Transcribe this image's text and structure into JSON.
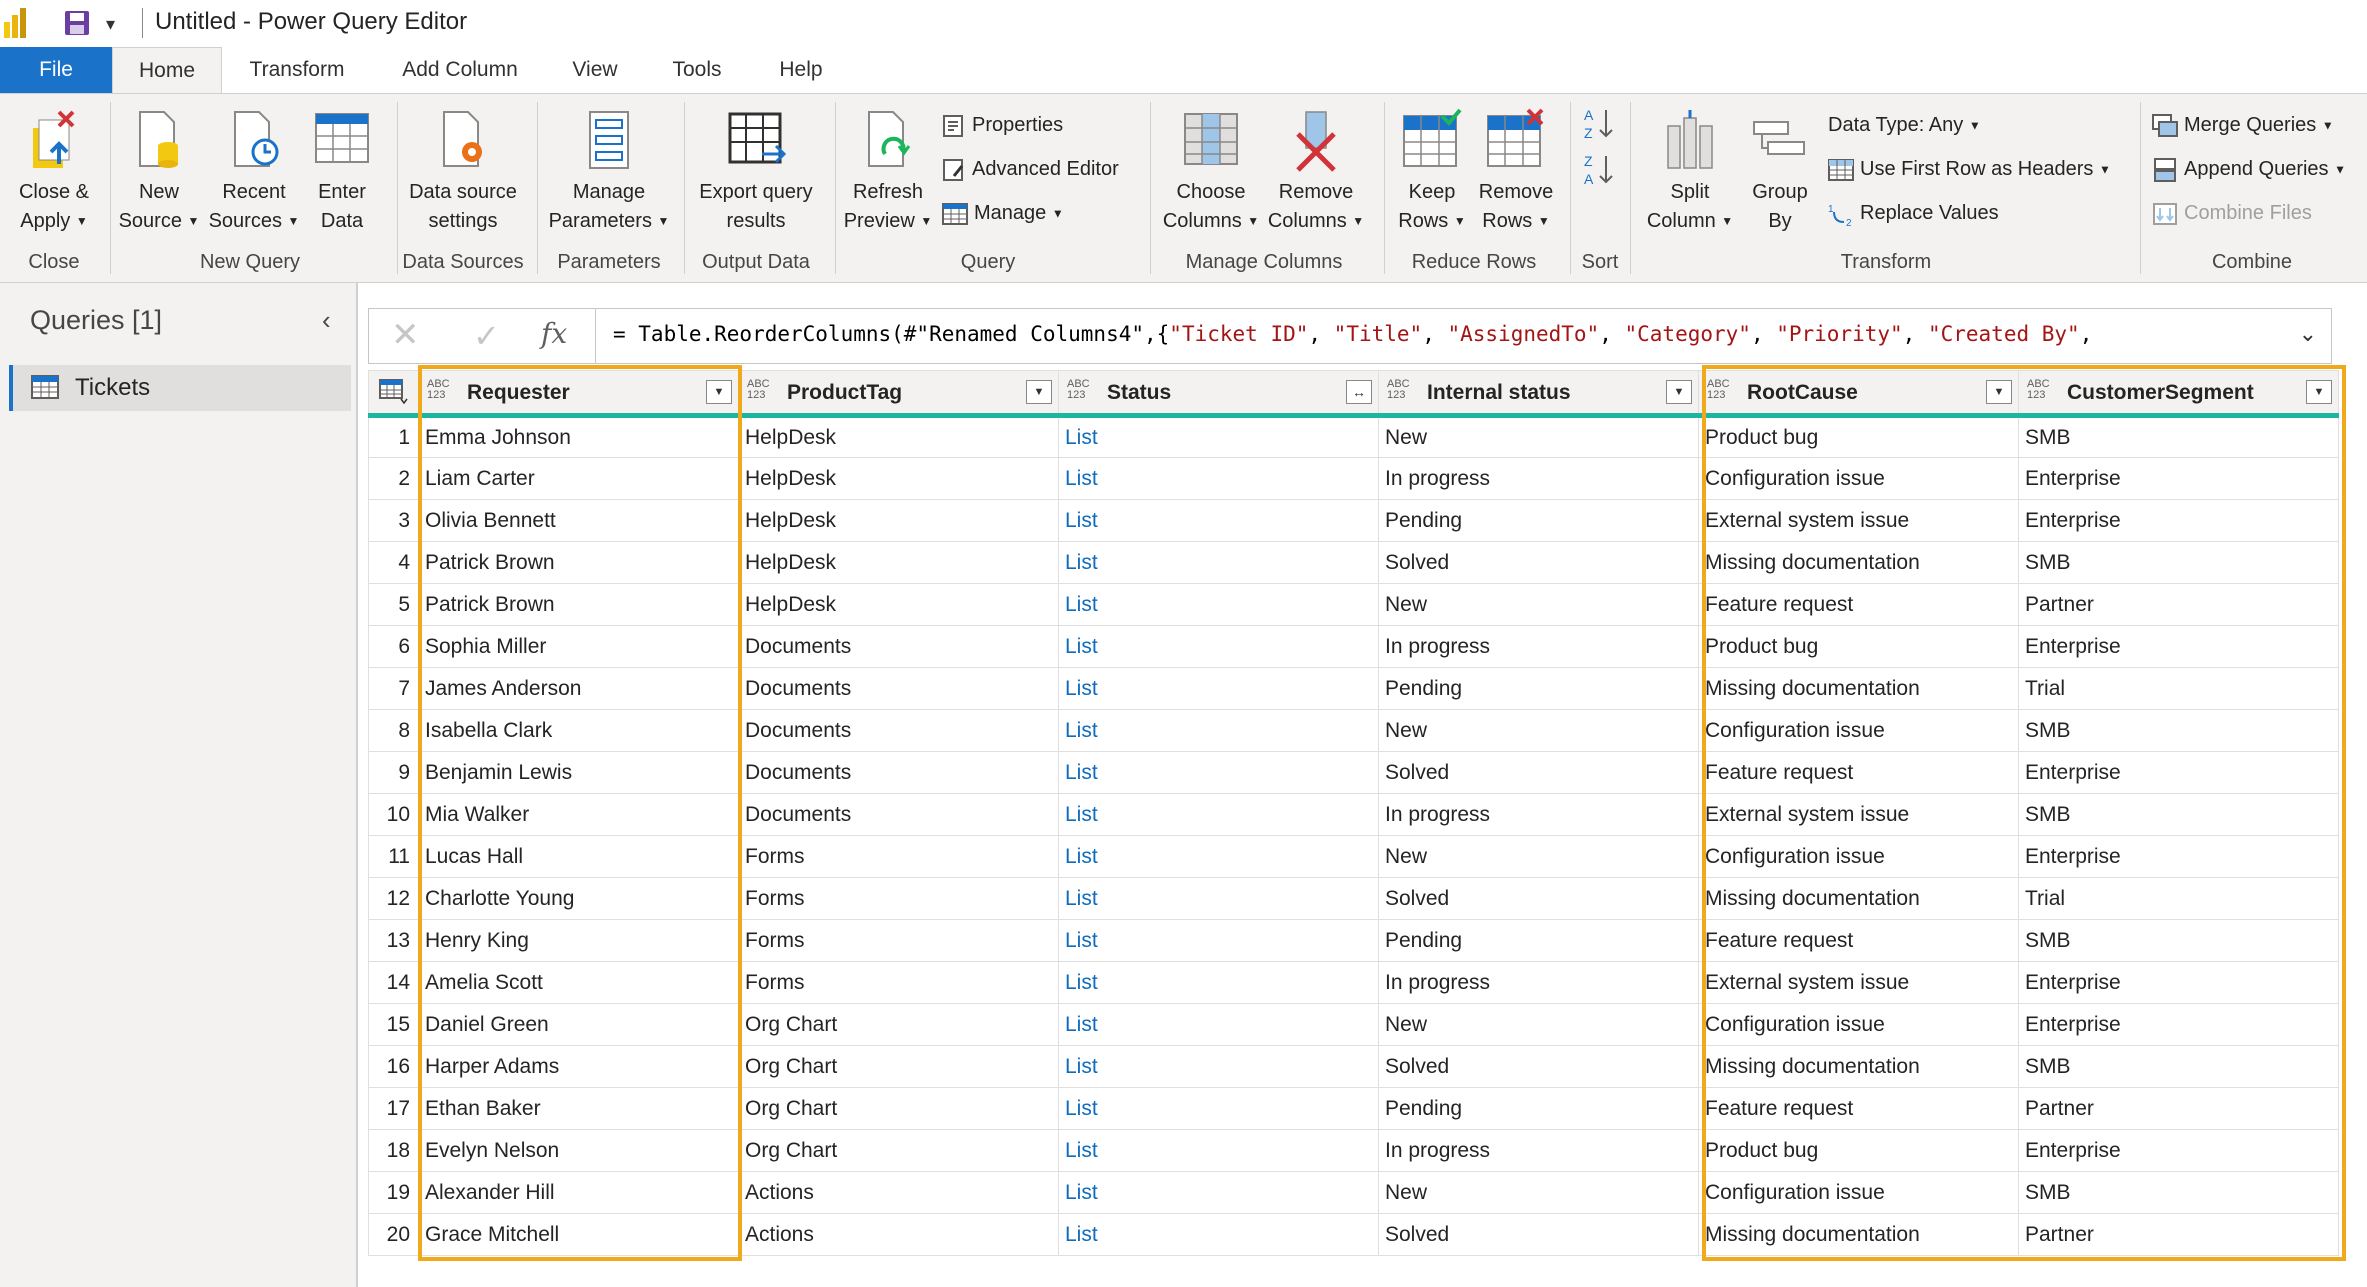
{
  "window": {
    "title": "Untitled - Power Query Editor"
  },
  "tabs": [
    "File",
    "Home",
    "Transform",
    "Add Column",
    "View",
    "Tools",
    "Help"
  ],
  "ribbon": {
    "close": {
      "close_apply": [
        "Close &",
        "Apply"
      ],
      "label": "Close"
    },
    "new_query": {
      "new_source": [
        "New",
        "Source"
      ],
      "recent_sources": [
        "Recent",
        "Sources"
      ],
      "enter_data": [
        "Enter",
        "Data"
      ],
      "label": "New Query"
    },
    "data_sources": {
      "settings": [
        "Data source",
        "settings"
      ],
      "label": "Data Sources"
    },
    "parameters": {
      "manage": [
        "Manage",
        "Parameters"
      ],
      "label": "Parameters"
    },
    "output_data": {
      "export": [
        "Export query",
        "results"
      ],
      "label": "Output Data"
    },
    "query": {
      "refresh": [
        "Refresh",
        "Preview"
      ],
      "properties": "Properties",
      "advanced_editor": "Advanced Editor",
      "manage": "Manage",
      "label": "Query"
    },
    "manage_columns": {
      "choose": [
        "Choose",
        "Columns"
      ],
      "remove": [
        "Remove",
        "Columns"
      ],
      "label": "Manage Columns"
    },
    "reduce_rows": {
      "keep": [
        "Keep",
        "Rows"
      ],
      "remove": [
        "Remove",
        "Rows"
      ],
      "label": "Reduce Rows"
    },
    "sort": {
      "label": "Sort"
    },
    "transform": {
      "split": [
        "Split",
        "Column"
      ],
      "group": [
        "Group",
        "By"
      ],
      "data_type": "Data Type: Any",
      "first_row": "Use First Row as Headers",
      "replace": "Replace Values",
      "label": "Transform"
    },
    "combine": {
      "merge": "Merge Queries",
      "append": "Append Queries",
      "combine_files": "Combine Files",
      "label": "Combine"
    }
  },
  "queries": {
    "title": "Queries [1]",
    "items": [
      "Tickets"
    ]
  },
  "formula_bar": {
    "prefix": "= Table.ReorderColumns(#\"Renamed Columns4\",{",
    "strings": [
      "\"Ticket ID\"",
      "\"Title\"",
      "\"AssignedTo\"",
      "\"Category\"",
      "\"Priority\"",
      "\"Created By\""
    ],
    "separator": ", ",
    "suffix": ","
  },
  "table": {
    "type_label": [
      "ABC",
      "123"
    ],
    "columns": [
      "Requester",
      "ProductTag",
      "Status",
      "Internal status",
      "RootCause",
      "CustomerSegment"
    ],
    "rows": [
      [
        "Emma Johnson",
        "HelpDesk",
        "List",
        "New",
        "Product bug",
        "SMB"
      ],
      [
        "Liam Carter",
        "HelpDesk",
        "List",
        "In progress",
        "Configuration issue",
        "Enterprise"
      ],
      [
        "Olivia Bennett",
        "HelpDesk",
        "List",
        "Pending",
        "External system issue",
        "Enterprise"
      ],
      [
        "Patrick Brown",
        "HelpDesk",
        "List",
        "Solved",
        "Missing documentation",
        "SMB"
      ],
      [
        "Patrick Brown",
        "HelpDesk",
        "List",
        "New",
        "Feature request",
        "Partner"
      ],
      [
        "Sophia Miller",
        "Documents",
        "List",
        "In progress",
        "Product bug",
        "Enterprise"
      ],
      [
        "James Anderson",
        "Documents",
        "List",
        "Pending",
        "Missing documentation",
        "Trial"
      ],
      [
        "Isabella Clark",
        "Documents",
        "List",
        "New",
        "Configuration issue",
        "SMB"
      ],
      [
        "Benjamin Lewis",
        "Documents",
        "List",
        "Solved",
        "Feature request",
        "Enterprise"
      ],
      [
        "Mia Walker",
        "Documents",
        "List",
        "In progress",
        "External system issue",
        "SMB"
      ],
      [
        "Lucas Hall",
        "Forms",
        "List",
        "New",
        "Configuration issue",
        "Enterprise"
      ],
      [
        "Charlotte Young",
        "Forms",
        "List",
        "Solved",
        "Missing documentation",
        "Trial"
      ],
      [
        "Henry King",
        "Forms",
        "List",
        "Pending",
        "Feature request",
        "SMB"
      ],
      [
        "Amelia Scott",
        "Forms",
        "List",
        "In progress",
        "External system issue",
        "Enterprise"
      ],
      [
        "Daniel Green",
        "Org Chart",
        "List",
        "New",
        "Configuration issue",
        "Enterprise"
      ],
      [
        "Harper Adams",
        "Org Chart",
        "List",
        "Solved",
        "Missing documentation",
        "SMB"
      ],
      [
        "Ethan Baker",
        "Org Chart",
        "List",
        "Pending",
        "Feature request",
        "Partner"
      ],
      [
        "Evelyn Nelson",
        "Org Chart",
        "List",
        "In progress",
        "Product bug",
        "Enterprise"
      ],
      [
        "Alexander Hill",
        "Actions",
        "List",
        "New",
        "Configuration issue",
        "SMB"
      ],
      [
        "Grace Mitchell",
        "Actions",
        "List",
        "Solved",
        "Missing documentation",
        "Partner"
      ]
    ]
  },
  "colors": {
    "accent": "#1a73c9",
    "highlight": "#f0a81c",
    "quality_bar": "#1bb5a0",
    "link": "#0f6cbd"
  }
}
